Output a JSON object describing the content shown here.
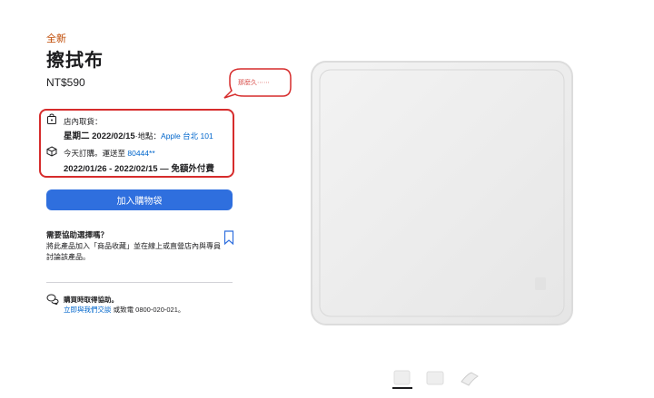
{
  "product": {
    "badge": "全新",
    "title": "擦拭布",
    "price": "NT$590"
  },
  "annotation": {
    "bubble_text": "那麼久⋯⋯",
    "accent": "#d62c2c"
  },
  "pickup": {
    "icon": "shopping-bag-icon",
    "label": "店內取貨：",
    "date_prefix": "星期二 2022/02/15",
    "location_prefix": "·地點：",
    "store": "Apple 台北 101"
  },
  "shipping": {
    "icon": "box-icon",
    "label_prefix": "今天訂購。運送至 ",
    "zip": "80444**",
    "window": "2022/01/26 - 2022/02/15 — 免額外付費"
  },
  "cart": {
    "add_label": "加入購物袋",
    "color": "#2f6fde"
  },
  "help": {
    "title": "需要協助選擇嗎？",
    "description": "將此產品加入「商品收藏」並在線上或直營店內與專員討論該產品。",
    "bookmark_icon": "bookmark-icon"
  },
  "chat": {
    "icon": "chat-bubbles-icon",
    "title": "購買時取得協助。",
    "link": "立即與我們交談",
    "phone_text": " 或致電 0800-020-021。"
  },
  "gallery": {
    "thumbnails": [
      "thumbnail-1",
      "thumbnail-2",
      "thumbnail-3"
    ]
  }
}
